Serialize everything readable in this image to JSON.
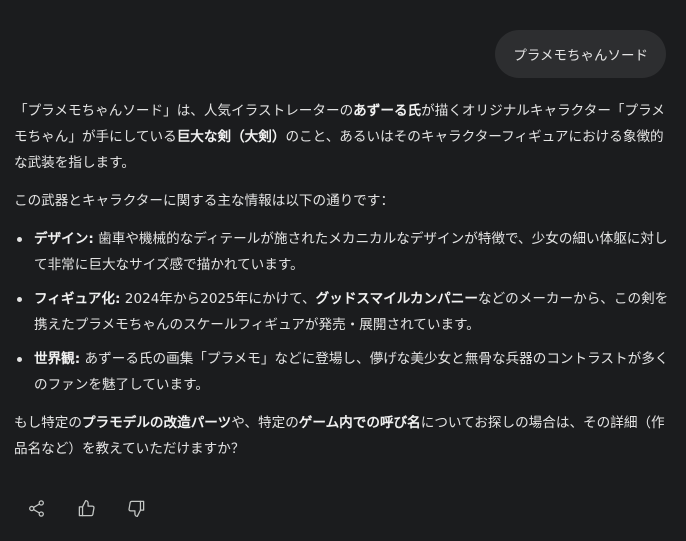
{
  "user_message": "プラメモちゃんソード",
  "response": {
    "intro": [
      {
        "t": "「プラメモちゃんソード」は、人気イラストレーターの",
        "b": false
      },
      {
        "t": "あずーる氏",
        "b": true
      },
      {
        "t": "が描くオリジナルキャラクター「プラメモちゃん」が手にしている",
        "b": false
      },
      {
        "t": "巨大な剣（大剣）",
        "b": true
      },
      {
        "t": "のこと、あるいはそのキャラクターフィギュアにおける象徴的な武装を指します。",
        "b": false
      }
    ],
    "lead": "この武器とキャラクターに関する主な情報は以下の通りです：",
    "bullets": [
      [
        {
          "t": "デザイン:",
          "b": true
        },
        {
          "t": " 歯車や機械的なディテールが施されたメカニカルなデザインが特徴で、少女の細い体躯に対して非常に巨大なサイズ感で描かれています。",
          "b": false
        }
      ],
      [
        {
          "t": "フィギュア化:",
          "b": true
        },
        {
          "t": " 2024年から2025年にかけて、",
          "b": false
        },
        {
          "t": "グッドスマイルカンパニー",
          "b": true
        },
        {
          "t": "などのメーカーから、この剣を携えたプラメモちゃんのスケールフィギュアが発売・展開されています。",
          "b": false
        }
      ],
      [
        {
          "t": "世界観:",
          "b": true
        },
        {
          "t": " あずーる氏の画集「プラメモ」などに登場し、儚げな美少女と無骨な兵器のコントラストが多くのファンを魅了しています。",
          "b": false
        }
      ]
    ],
    "closing": [
      {
        "t": "もし特定の",
        "b": false
      },
      {
        "t": "プラモデルの改造パーツ",
        "b": true
      },
      {
        "t": "や、特定の",
        "b": false
      },
      {
        "t": "ゲーム内での呼び名",
        "b": true
      },
      {
        "t": "についてお探しの場合は、その詳細（作品名など）を教えていただけますか？",
        "b": false
      }
    ]
  },
  "actions": [
    {
      "name": "share-button",
      "icon": "share-icon"
    },
    {
      "name": "thumbs-up-button",
      "icon": "thumbs-up-icon"
    },
    {
      "name": "thumbs-down-button",
      "icon": "thumbs-down-icon"
    }
  ]
}
